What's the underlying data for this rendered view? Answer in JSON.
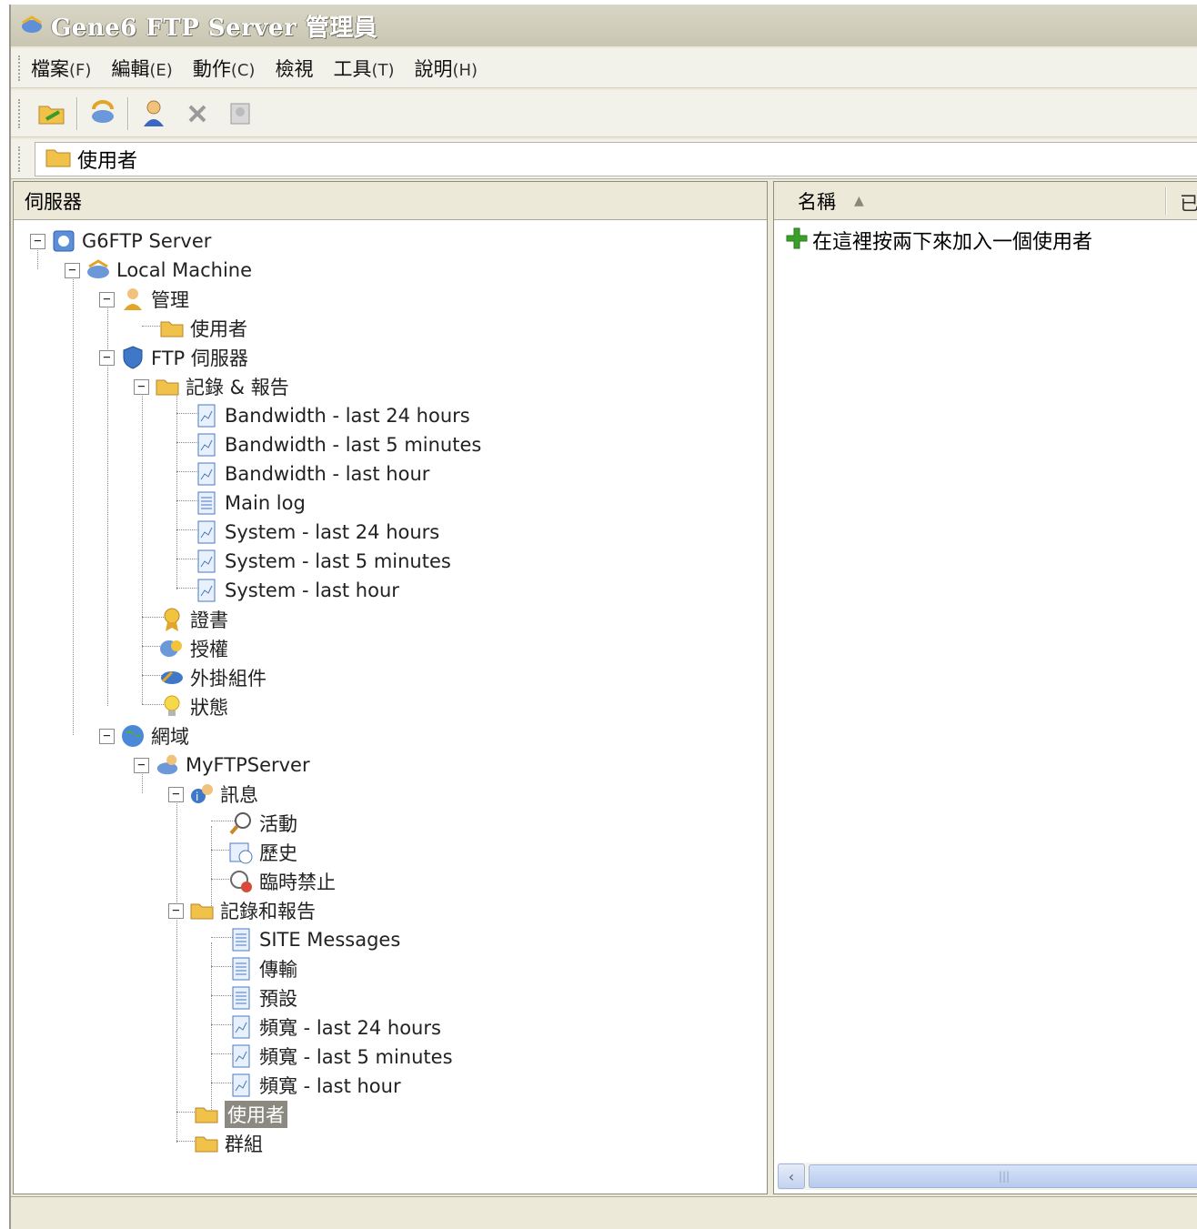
{
  "window": {
    "title": "Gene6 FTP Server 管理員"
  },
  "menu": [
    {
      "label": "檔案",
      "accel": "(F)"
    },
    {
      "label": "編輯",
      "accel": "(E)"
    },
    {
      "label": "動作",
      "accel": "(C)"
    },
    {
      "label": "檢視",
      "accel": ""
    },
    {
      "label": "工具",
      "accel": "(T)"
    },
    {
      "label": "說明",
      "accel": "(H)"
    }
  ],
  "toolbar": {
    "icons": [
      "open-folder-icon",
      "refresh-icon",
      "user-icon",
      "delete-icon",
      "properties-icon"
    ]
  },
  "address": {
    "path": "使用者"
  },
  "left_pane": {
    "header": "伺服器",
    "tree": {
      "root": "G6FTP Server",
      "local_machine": "Local Machine",
      "admin": "管理",
      "admin_users": "使用者",
      "ftp_server": "FTP 伺服器",
      "logs_reports": "記錄 & 報告",
      "log_items": [
        "Bandwidth - last 24 hours",
        "Bandwidth - last 5 minutes",
        "Bandwidth - last hour",
        "Main log",
        "System - last 24 hours",
        "System - last 5 minutes",
        "System - last hour"
      ],
      "certificates": "證書",
      "license": "授權",
      "plugins": "外掛組件",
      "status": "狀態",
      "domains": "網域",
      "domain_name": "MyFTPServer",
      "info": "訊息",
      "activity": "活動",
      "history": "歷史",
      "temp_ban": "臨時禁止",
      "domain_logs": "記錄和報告",
      "domain_log_items": [
        {
          "prefix": "SITE Messages",
          "suffix": ""
        },
        {
          "prefix": "傳輸",
          "suffix": ""
        },
        {
          "prefix": "預設",
          "suffix": ""
        },
        {
          "prefix": "頻寬",
          "suffix": " - last 24 hours"
        },
        {
          "prefix": "頻寬",
          "suffix": " - last 5 minutes"
        },
        {
          "prefix": "頻寬",
          "suffix": " - last hour"
        }
      ],
      "domain_users": "使用者",
      "domain_groups": "群組"
    }
  },
  "right_pane": {
    "column_name": "名稱",
    "column_next": "已",
    "add_user_hint": "在這裡按兩下來加入一個使用者"
  },
  "colors": {
    "selection": "#8c8a80",
    "window": "#ece9d8",
    "add_icon": "#3aa02a"
  }
}
